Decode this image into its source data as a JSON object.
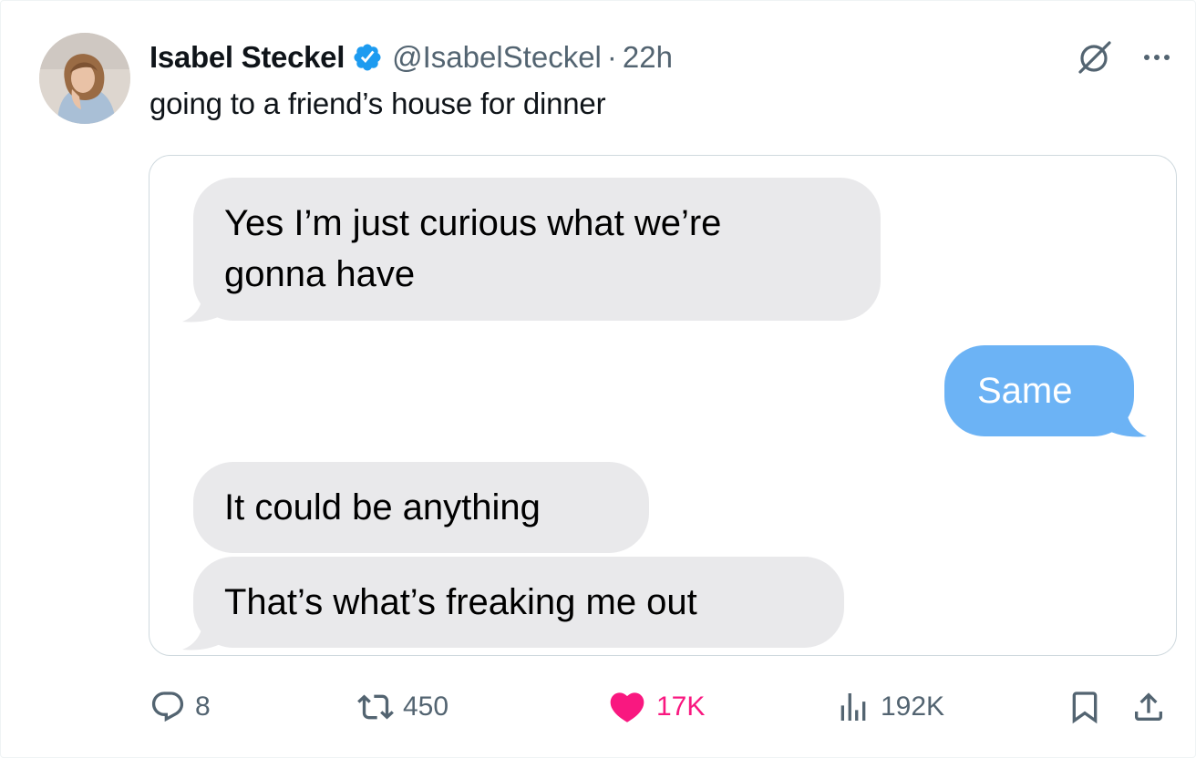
{
  "author": {
    "display_name": "Isabel Steckel",
    "handle": "@IsabelSteckel",
    "separator": "·",
    "time": "22h",
    "verified": true,
    "avatar_icon": "profile-photo"
  },
  "tweet": {
    "text": "going to a friend’s house for dinner"
  },
  "media": {
    "messages": [
      {
        "from": "other",
        "lines": [
          "Yes I’m just curious what we’re",
          "gonna have"
        ]
      },
      {
        "from": "me",
        "lines": [
          "Same"
        ]
      },
      {
        "from": "other",
        "lines": [
          "It could be anything"
        ]
      },
      {
        "from": "other",
        "lines": [
          "That’s what’s freaking me out"
        ]
      }
    ]
  },
  "actions": {
    "replies": "8",
    "reposts": "450",
    "likes": "17K",
    "views": "192K",
    "reply_icon": "reply-icon",
    "repost_icon": "repost-icon",
    "like_icon": "heart-icon",
    "views_icon": "views-icon",
    "bookmark_icon": "bookmark-icon",
    "share_icon": "share-icon"
  },
  "colors": {
    "verified_blue": "#1d9bf0",
    "imessage_blue": "#6cb3f5",
    "imessage_gray": "#e9e9eb",
    "like_pink": "#f91880",
    "secondary_text": "#536471"
  }
}
